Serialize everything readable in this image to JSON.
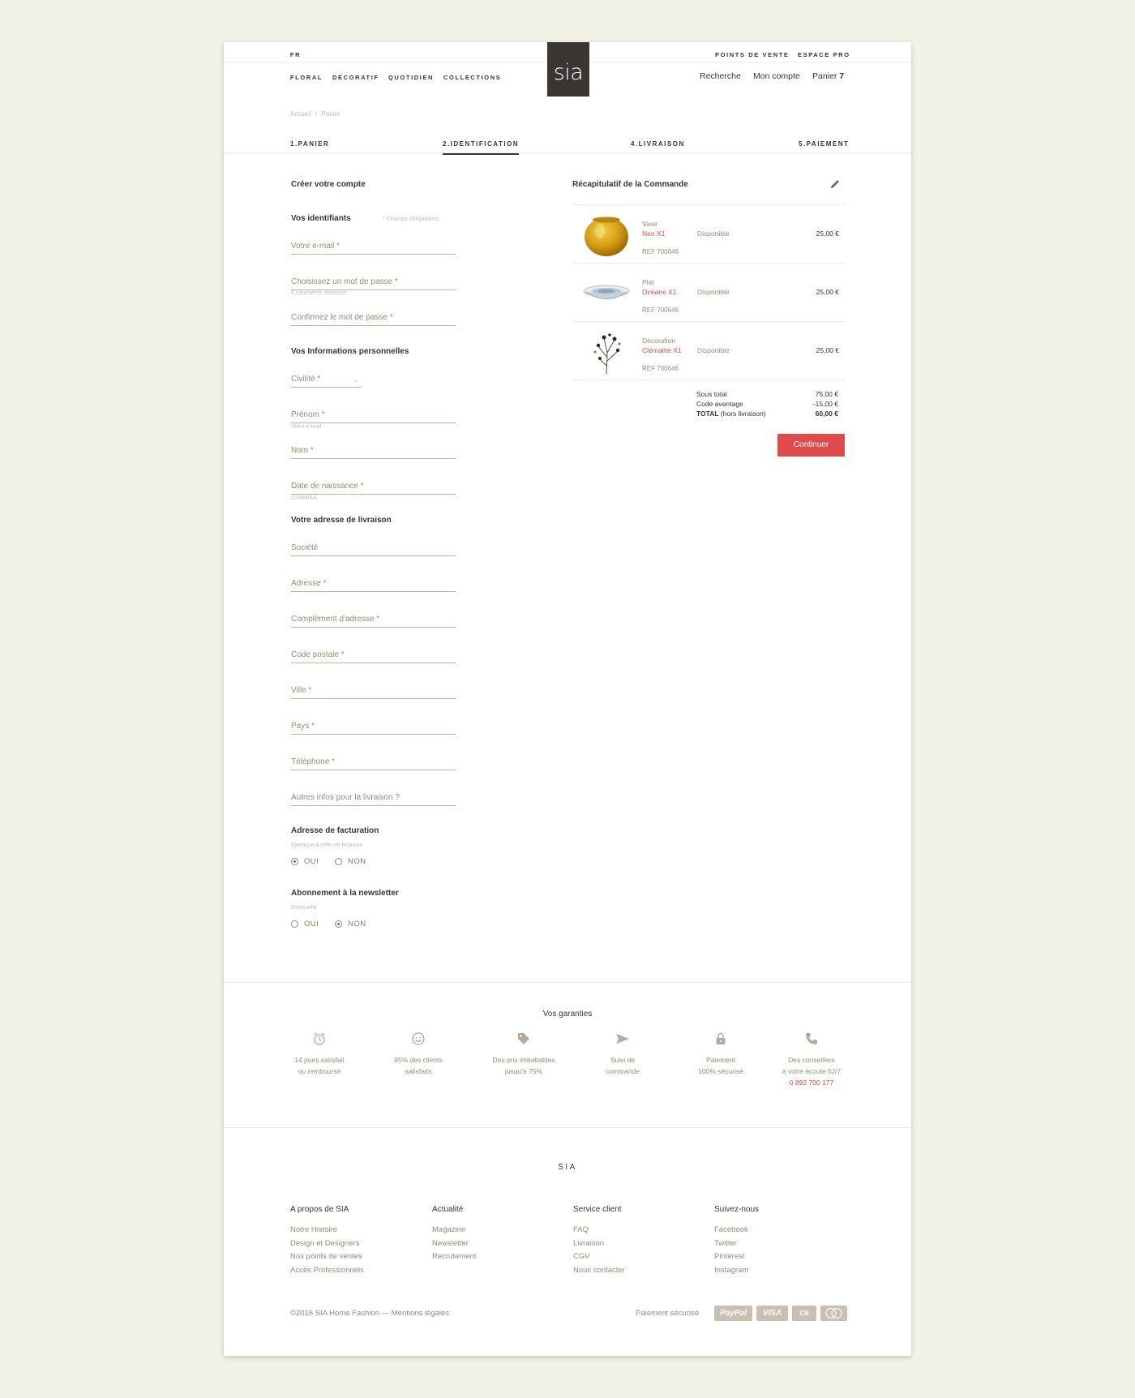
{
  "header": {
    "lang": "FR",
    "top_links": [
      "POINTS DE VENTE",
      "ESPACE PRO"
    ],
    "nav": [
      "FLORAL",
      "DÉCORATIF",
      "QUOTIDIEN",
      "COLLECTIONS"
    ],
    "logo": "sia",
    "search": "Recherche",
    "account": "Mon compte",
    "cart_label": "Panier",
    "cart_count": "7"
  },
  "breadcrumb": [
    "Accueil",
    "Panier"
  ],
  "steps": [
    "1.PANIER",
    "2.IDENTIFICATION",
    "4.LIVRAISON",
    "5.PAIEMENT"
  ],
  "form": {
    "create_title": "Créer votre compte",
    "identifiers_title": "Vos identifiants",
    "required_note": "* Champs obligatoires",
    "email": "Votre e-mail *",
    "password": "Choisissez un mot de passe *",
    "password_hint": "8 caractères minimum",
    "confirm": "Confirmez le mot de passe *",
    "personal_title": "Vos Informations personnelles",
    "civility": "Civilité *",
    "firstname": "Prénom *",
    "firstname_hint": "Votre e-mail",
    "lastname": "Nom *",
    "birthdate": "Date de naissance *",
    "birthdate_hint": "JJ/MM/AA",
    "delivery_title": "Votre adresse de livraison",
    "company": "Société",
    "address": "Adresse *",
    "address2": "Complément d'adresse *",
    "zip": "Code postale *",
    "city": "Ville *",
    "country": "Pays *",
    "phone": "Téléphone *",
    "other": "Autres infos pour la livraison ?",
    "billing_title": "Adresse de facturation",
    "billing_hint": "Identique à celle de livraison",
    "yes": "OUI",
    "no": "NON",
    "newsletter_title": "Abonnement à la newsletter",
    "newsletter_hint": "Mensuelle"
  },
  "summary": {
    "title": "Récapitulatif de la Commande",
    "items": [
      {
        "category": "Vase",
        "name": "Neo X1",
        "ref": "REF 700646",
        "availability": "Disponible",
        "price": "25,00 €",
        "thumb": "yellow-vase"
      },
      {
        "category": "Plat",
        "name": "Oceane X1",
        "ref": "REF 700646",
        "availability": "Disponible",
        "price": "25,00 €",
        "thumb": "blue-plate"
      },
      {
        "category": "Décoration",
        "name": "Clématite X1",
        "ref": "REF 700646",
        "availability": "Disponible",
        "price": "25,00 €",
        "thumb": "flower-branch"
      }
    ],
    "subtotal_label": "Sous total",
    "subtotal": "75,00 €",
    "promo_label": "Code avantage",
    "promo": "-15,00 €",
    "total_label": "TOTAL",
    "total_suffix": " (hors livraison)",
    "total": "60,00 €",
    "continue": "Continuer"
  },
  "guarantees": {
    "title": "Vos garanties",
    "items": [
      {
        "icon": "alarm-clock-icon",
        "line1": "14 jours satisfait",
        "line2": "ou remboursé"
      },
      {
        "icon": "smiley-icon",
        "line1": "95% des clients",
        "line2": "satisfaits"
      },
      {
        "icon": "price-tag-icon",
        "line1": "Des prix imbattables",
        "line2": "jusqu'à 75%"
      },
      {
        "icon": "send-icon",
        "line1": "Suivi de",
        "line2": "commande"
      },
      {
        "icon": "lock-icon",
        "line1": "Paiement",
        "line2": "100% sécurisé"
      },
      {
        "icon": "phone-icon",
        "line1": "Des conseillers",
        "line2": "à votre écoute 6J/7",
        "line3": "0 892 700 177"
      }
    ]
  },
  "footer": {
    "brand": "SIA",
    "columns": [
      {
        "title": "A propos de SIA",
        "links": [
          "Notre Histoire",
          "Design et Designers",
          "Nos points de ventes",
          "Accès Professionnels"
        ]
      },
      {
        "title": "Actualité",
        "links": [
          "Magazine",
          "Newsletter",
          "Recrutement"
        ]
      },
      {
        "title": "Service client",
        "links": [
          "FAQ",
          "Livraison",
          "CGV",
          "Nous contacter"
        ]
      },
      {
        "title": "Suivez-nous",
        "links": [
          "Facebook",
          "Twitter",
          "Pinterest",
          "Instagram"
        ]
      }
    ],
    "copyright": "©2016 SIA Home Fashion — Mentions légales",
    "secure_payment": "Paiement sécurisé",
    "payment_methods": [
      "PayPal",
      "VISA",
      "CB",
      "MasterCard"
    ]
  },
  "colors": {
    "accent": "#e04a4a",
    "dark": "#3b3633",
    "muted": "#9a8a76",
    "background": "#f1f1e5"
  }
}
